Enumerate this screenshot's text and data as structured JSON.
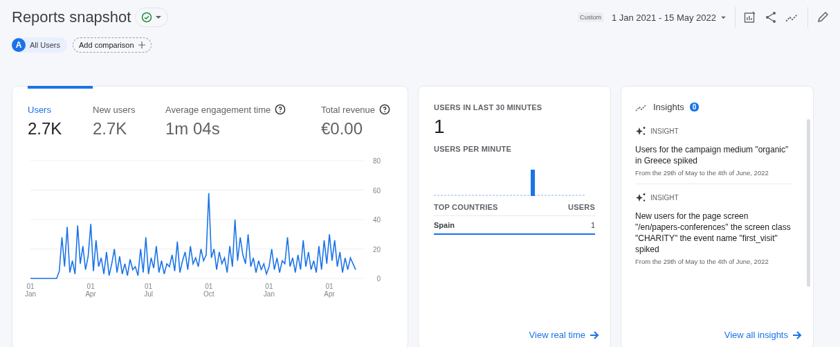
{
  "header": {
    "title": "Reports snapshot",
    "date_preset": "Custom",
    "date_range": "1 Jan 2021 - 15 May 2022"
  },
  "comparisons": {
    "segment_letter": "A",
    "segment": "All Users",
    "add_label": "Add comparison"
  },
  "overview": {
    "metrics": [
      {
        "label": "Users",
        "value": "2.7K",
        "selected": true,
        "help": false
      },
      {
        "label": "New users",
        "value": "2.7K",
        "selected": false,
        "help": false
      },
      {
        "label": "Average engagement time",
        "value": "1m 04s",
        "selected": false,
        "help": true
      },
      {
        "label": "Total revenue",
        "value": "€0.00",
        "selected": false,
        "help": true
      }
    ],
    "chart_data": {
      "type": "line",
      "grid": true,
      "ylim": [
        0,
        80
      ],
      "yticks": [
        0,
        20,
        40,
        60,
        80
      ],
      "categories": [
        "01 Jan",
        null,
        null,
        null,
        null,
        null,
        null,
        null,
        null,
        null,
        null,
        null,
        null,
        null,
        null,
        null,
        null,
        null,
        null,
        null,
        null,
        null,
        null,
        "01 Apr",
        null,
        null,
        null,
        null,
        null,
        null,
        null,
        null,
        null,
        null,
        null,
        null,
        null,
        null,
        null,
        null,
        null,
        null,
        null,
        null,
        null,
        "01 Jul",
        null,
        null,
        null,
        null,
        null,
        null,
        null,
        null,
        null,
        null,
        null,
        null,
        null,
        null,
        null,
        null,
        null,
        null,
        null,
        null,
        null,
        null,
        "01 Oct",
        null,
        null,
        null,
        null,
        null,
        null,
        null,
        null,
        null,
        null,
        null,
        null,
        null,
        null,
        null,
        null,
        null,
        null,
        null,
        null,
        null,
        null,
        "01 Jan",
        null,
        null,
        null,
        null,
        null,
        null,
        null,
        null,
        null,
        null,
        null,
        null,
        null,
        null,
        null,
        null,
        null,
        null,
        null,
        null,
        null,
        null,
        "01 Apr",
        null,
        null,
        null,
        null,
        null,
        null,
        null,
        null,
        null,
        null
      ],
      "values": [
        0,
        0,
        0,
        0,
        0,
        0,
        0,
        0,
        0,
        0,
        0,
        5,
        28,
        8,
        35,
        4,
        12,
        3,
        36,
        10,
        22,
        6,
        15,
        37,
        5,
        26,
        8,
        14,
        3,
        18,
        2,
        10,
        20,
        4,
        15,
        3,
        10,
        2,
        13,
        6,
        8,
        2,
        20,
        4,
        28,
        3,
        14,
        7,
        22,
        4,
        12,
        3,
        10,
        8,
        16,
        5,
        25,
        4,
        12,
        18,
        6,
        22,
        10,
        14,
        8,
        20,
        12,
        16,
        58,
        14,
        20,
        6,
        18,
        10,
        14,
        4,
        22,
        8,
        40,
        12,
        28,
        16,
        10,
        30,
        8,
        14,
        4,
        12,
        6,
        10,
        3,
        8,
        20,
        6,
        14,
        4,
        12,
        10,
        28,
        8,
        14,
        4,
        16,
        6,
        26,
        8,
        18,
        6,
        12,
        4,
        22,
        6,
        26,
        10,
        30,
        12,
        26,
        8,
        18,
        4,
        14,
        6,
        14,
        10,
        6
      ]
    }
  },
  "realtime": {
    "title": "USERS IN LAST 30 MINUTES",
    "value": "1",
    "per_minute_label": "USERS PER MINUTE",
    "table": {
      "columns": [
        "TOP COUNTRIES",
        "USERS"
      ],
      "rows": [
        {
          "country": "Spain",
          "users": "1"
        }
      ]
    },
    "link": "View real time"
  },
  "insights": {
    "title": "Insights",
    "count": "0",
    "items": [
      {
        "tag": "INSIGHT",
        "text": "Users for the campaign medium \"organic\" in Greece spiked",
        "date": "From the 29th of May to the 4th of June, 2022"
      },
      {
        "tag": "INSIGHT",
        "text": "New users for the page screen \"/en/papers-conferences\" the screen class \"CHARITY\" the event name \"first_visit\" spiked",
        "date": "From the 29th of May to the 4th of June, 2022"
      }
    ],
    "link": "View all insights"
  }
}
